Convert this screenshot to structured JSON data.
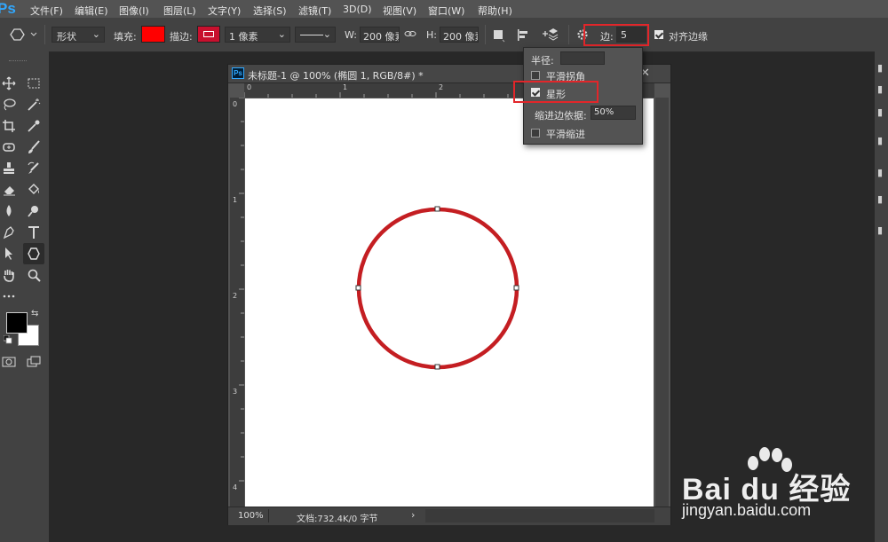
{
  "app": {
    "logo": "Ps"
  },
  "menu": [
    "文件(F)",
    "编辑(E)",
    "图像(I)",
    "图层(L)",
    "文字(Y)",
    "选择(S)",
    "滤镜(T)",
    "3D(D)",
    "视图(V)",
    "窗口(W)",
    "帮助(H)"
  ],
  "options": {
    "mode": "形状",
    "fill_label": "填充:",
    "fill_color": "#ff0000",
    "stroke_label": "描边:",
    "stroke_color": "#c8102e",
    "stroke_width": "1 像素",
    "w_label": "W:",
    "w_value": "200 像素",
    "h_label": "H:",
    "h_value": "200 像素",
    "sides_label": "边:",
    "sides_value": "5",
    "align_edges": "对齐边缘"
  },
  "document": {
    "tab_title": "未标题-1 @ 100% (椭圆 1, RGB/8#) *",
    "ruler_h": [
      "0",
      "1",
      "2"
    ],
    "ruler_v": [
      "0",
      "1",
      "2",
      "3",
      "4"
    ],
    "zoom": "100%",
    "doc_info": "文档:732.4K/0 字节",
    "shape_color": "#c41e22"
  },
  "polygon_options": {
    "radius_label": "半径:",
    "smooth_corners": "平滑拐角",
    "star": "星形",
    "indent_label": "缩进边依据:",
    "indent_value": "50%",
    "smooth_indents": "平滑缩进"
  },
  "watermark": {
    "brand": "Bai du 经验",
    "url": "jingyan.baidu.com"
  }
}
